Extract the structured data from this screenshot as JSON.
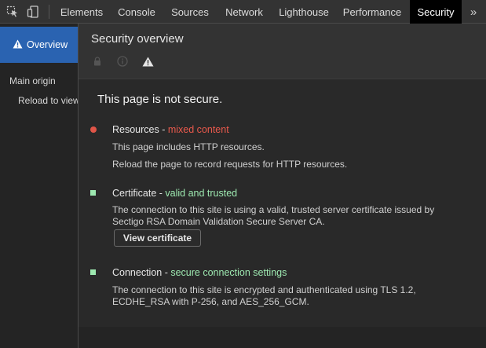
{
  "toolbar": {
    "icons": [
      "inspect-element-icon",
      "device-toggle-icon"
    ],
    "tabs": [
      {
        "label": "Elements"
      },
      {
        "label": "Console"
      },
      {
        "label": "Sources"
      },
      {
        "label": "Network"
      },
      {
        "label": "Lighthouse"
      },
      {
        "label": "Performance"
      },
      {
        "label": "Security",
        "active": true
      }
    ],
    "more_label": "»"
  },
  "sidebar": {
    "overview_label": "Overview",
    "main_origin_label": "Main origin",
    "reload_label": "Reload to view"
  },
  "main": {
    "title": "Security overview",
    "state_icons": [
      "lock-icon",
      "info-icon",
      "warning-icon"
    ],
    "summary": "This page is not secure.",
    "resources": {
      "name": "Resources",
      "separator": " - ",
      "status": "mixed content",
      "desc1": "This page includes HTTP resources.",
      "desc2": "Reload the page to record requests for HTTP resources."
    },
    "certificate": {
      "name": "Certificate",
      "separator": " - ",
      "status": "valid and trusted",
      "desc": "The connection to this site is using a valid, trusted server certificate issued by Sectigo RSA Domain Validation Secure Server CA.",
      "button_label": "View certificate"
    },
    "connection": {
      "name": "Connection",
      "separator": " - ",
      "status": "secure connection settings",
      "desc": "The connection to this site is encrypted and authenticated using TLS 1.2, ECDHE_RSA with P-256, and AES_256_GCM."
    }
  },
  "colors": {
    "accent": "#2a63b1",
    "insecure": "#e9594c",
    "secure": "#9de8b0"
  }
}
